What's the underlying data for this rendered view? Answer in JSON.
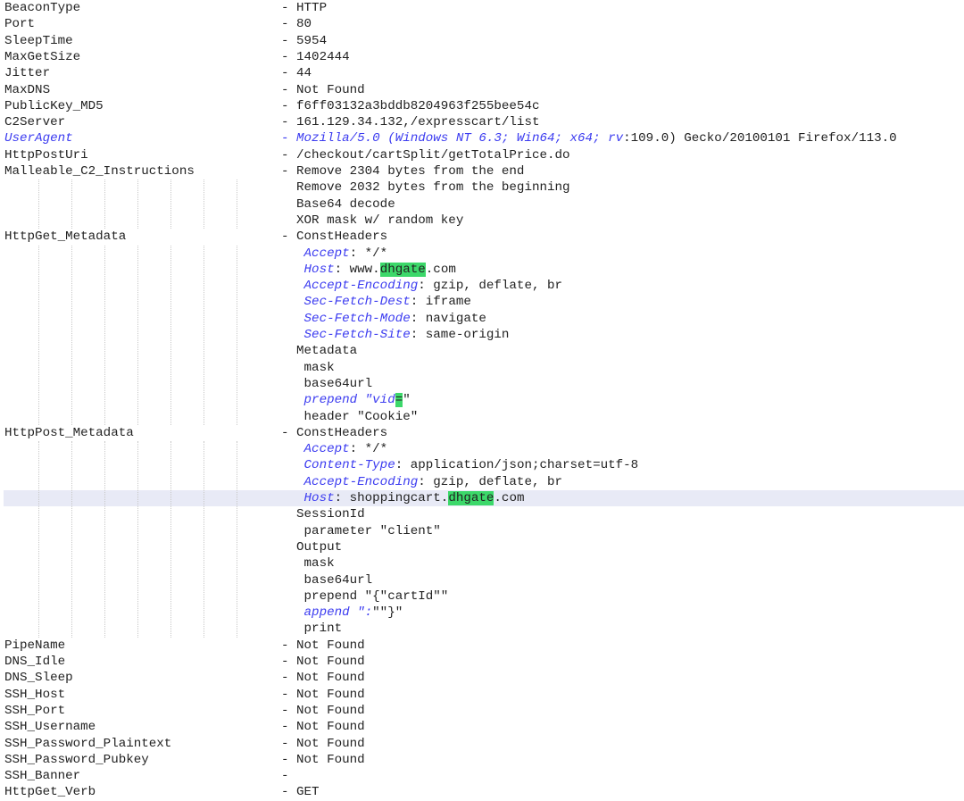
{
  "editor": {
    "lines": [
      {
        "key": "BeaconType",
        "segs": [
          {
            "t": "- HTTP"
          }
        ]
      },
      {
        "key": "Port",
        "segs": [
          {
            "t": "- 80"
          }
        ]
      },
      {
        "key": "SleepTime",
        "segs": [
          {
            "t": "- 5954"
          }
        ]
      },
      {
        "key": "MaxGetSize",
        "segs": [
          {
            "t": "- 1402444"
          }
        ]
      },
      {
        "key": "Jitter",
        "segs": [
          {
            "t": "- 44"
          }
        ]
      },
      {
        "key": "MaxDNS",
        "segs": [
          {
            "t": "- Not Found"
          }
        ]
      },
      {
        "key": "PublicKey_MD5",
        "segs": [
          {
            "t": "- f6ff03132a3bddb8204963f255bee54c"
          }
        ]
      },
      {
        "key": "C2Server",
        "segs": [
          {
            "t": "- 161.129.34.132,/expresscart/list"
          }
        ]
      },
      {
        "key": "UserAgent",
        "key_blue": true,
        "segs": [
          {
            "t": "- Mozilla/5.0 (Windows NT 6.3; Win64; x64; ",
            "c": "blue"
          },
          {
            "t": "rv",
            "c": "blue"
          },
          {
            "t": ":109.0) Gecko/20100101 Firefox/113.0"
          }
        ]
      },
      {
        "key": "HttpPostUri",
        "segs": [
          {
            "t": "- /checkout/cartSplit/getTotalPrice.do"
          }
        ]
      },
      {
        "key": "Malleable_C2_Instructions",
        "segs": [
          {
            "t": "- Remove 2304 bytes from the end"
          }
        ]
      },
      {
        "key": "",
        "segs": [
          {
            "t": "  Remove 2032 bytes from the beginning"
          }
        ]
      },
      {
        "key": "",
        "segs": [
          {
            "t": "  Base64 decode"
          }
        ]
      },
      {
        "key": "",
        "segs": [
          {
            "t": "  XOR mask w/ random key"
          }
        ]
      },
      {
        "key": "HttpGet_Metadata",
        "segs": [
          {
            "t": "- ConstHeaders"
          }
        ]
      },
      {
        "key": "",
        "segs": [
          {
            "t": "   Accept",
            "c": "blue"
          },
          {
            "t": ": */*"
          }
        ]
      },
      {
        "key": "",
        "segs": [
          {
            "t": "   Host",
            "c": "blue"
          },
          {
            "t": ": www."
          },
          {
            "t": "dhgate",
            "c": "hl"
          },
          {
            "t": ".com"
          }
        ]
      },
      {
        "key": "",
        "segs": [
          {
            "t": "   Accept-Encoding",
            "c": "blue"
          },
          {
            "t": ": gzip, deflate, br"
          }
        ]
      },
      {
        "key": "",
        "segs": [
          {
            "t": "   Sec-Fetch-Dest",
            "c": "blue"
          },
          {
            "t": ": iframe"
          }
        ]
      },
      {
        "key": "",
        "segs": [
          {
            "t": "   Sec-Fetch-Mode",
            "c": "blue"
          },
          {
            "t": ": navigate"
          }
        ]
      },
      {
        "key": "",
        "segs": [
          {
            "t": "   Sec-Fetch-Site",
            "c": "blue"
          },
          {
            "t": ": same-origin"
          }
        ]
      },
      {
        "key": "",
        "segs": [
          {
            "t": "  Metadata"
          }
        ]
      },
      {
        "key": "",
        "segs": [
          {
            "t": "   mask"
          }
        ]
      },
      {
        "key": "",
        "segs": [
          {
            "t": "   base64url"
          }
        ]
      },
      {
        "key": "",
        "segs": [
          {
            "t": "   prepend \"vid",
            "c": "blue"
          },
          {
            "t": "=",
            "c": "hl"
          },
          {
            "t": "\""
          }
        ]
      },
      {
        "key": "",
        "segs": [
          {
            "t": "   header \"Cookie\""
          }
        ]
      },
      {
        "key": "HttpPost_Metadata",
        "segs": [
          {
            "t": "- ConstHeaders"
          }
        ]
      },
      {
        "key": "",
        "segs": [
          {
            "t": "   Accept",
            "c": "blue"
          },
          {
            "t": ": */*"
          }
        ]
      },
      {
        "key": "",
        "segs": [
          {
            "t": "   Content-Type",
            "c": "blue"
          },
          {
            "t": ": application/json;charset=utf-8"
          }
        ]
      },
      {
        "key": "",
        "segs": [
          {
            "t": "   Accept-Encoding",
            "c": "blue"
          },
          {
            "t": ": gzip, deflate, br"
          }
        ]
      },
      {
        "key": "",
        "current": true,
        "segs": [
          {
            "t": "   Host",
            "c": "blue"
          },
          {
            "t": ": shoppingcart."
          },
          {
            "t": "dhgate",
            "c": "hl"
          },
          {
            "t": ".com"
          }
        ]
      },
      {
        "key": "",
        "segs": [
          {
            "t": "  SessionId"
          }
        ]
      },
      {
        "key": "",
        "segs": [
          {
            "t": "   parameter \"client\""
          }
        ]
      },
      {
        "key": "",
        "segs": [
          {
            "t": "  Output"
          }
        ]
      },
      {
        "key": "",
        "segs": [
          {
            "t": "   mask"
          }
        ]
      },
      {
        "key": "",
        "segs": [
          {
            "t": "   base64url"
          }
        ]
      },
      {
        "key": "",
        "segs": [
          {
            "t": "   prepend \"{\"cartId\"\""
          }
        ]
      },
      {
        "key": "",
        "segs": [
          {
            "t": "   append \":",
            "c": "blue"
          },
          {
            "t": "\"\"}\""
          }
        ]
      },
      {
        "key": "",
        "segs": [
          {
            "t": "   print"
          }
        ]
      },
      {
        "key": "PipeName",
        "segs": [
          {
            "t": "- Not Found"
          }
        ]
      },
      {
        "key": "DNS_Idle",
        "segs": [
          {
            "t": "- Not Found"
          }
        ]
      },
      {
        "key": "DNS_Sleep",
        "segs": [
          {
            "t": "- Not Found"
          }
        ]
      },
      {
        "key": "SSH_Host",
        "segs": [
          {
            "t": "- Not Found"
          }
        ]
      },
      {
        "key": "SSH_Port",
        "segs": [
          {
            "t": "- Not Found"
          }
        ]
      },
      {
        "key": "SSH_Username",
        "segs": [
          {
            "t": "- Not Found"
          }
        ]
      },
      {
        "key": "SSH_Password_Plaintext",
        "segs": [
          {
            "t": "- Not Found"
          }
        ]
      },
      {
        "key": "SSH_Password_Pubkey",
        "segs": [
          {
            "t": "- Not Found"
          }
        ]
      },
      {
        "key": "SSH_Banner",
        "segs": [
          {
            "t": "-"
          }
        ]
      },
      {
        "key": "HttpGet_Verb",
        "segs": [
          {
            "t": "- GET"
          }
        ]
      }
    ]
  },
  "colors": {
    "text": "#222222",
    "keyword_blue": "#3c3cf0",
    "match_highlight": "#3cd86a",
    "current_line": "#e8eaf6"
  }
}
